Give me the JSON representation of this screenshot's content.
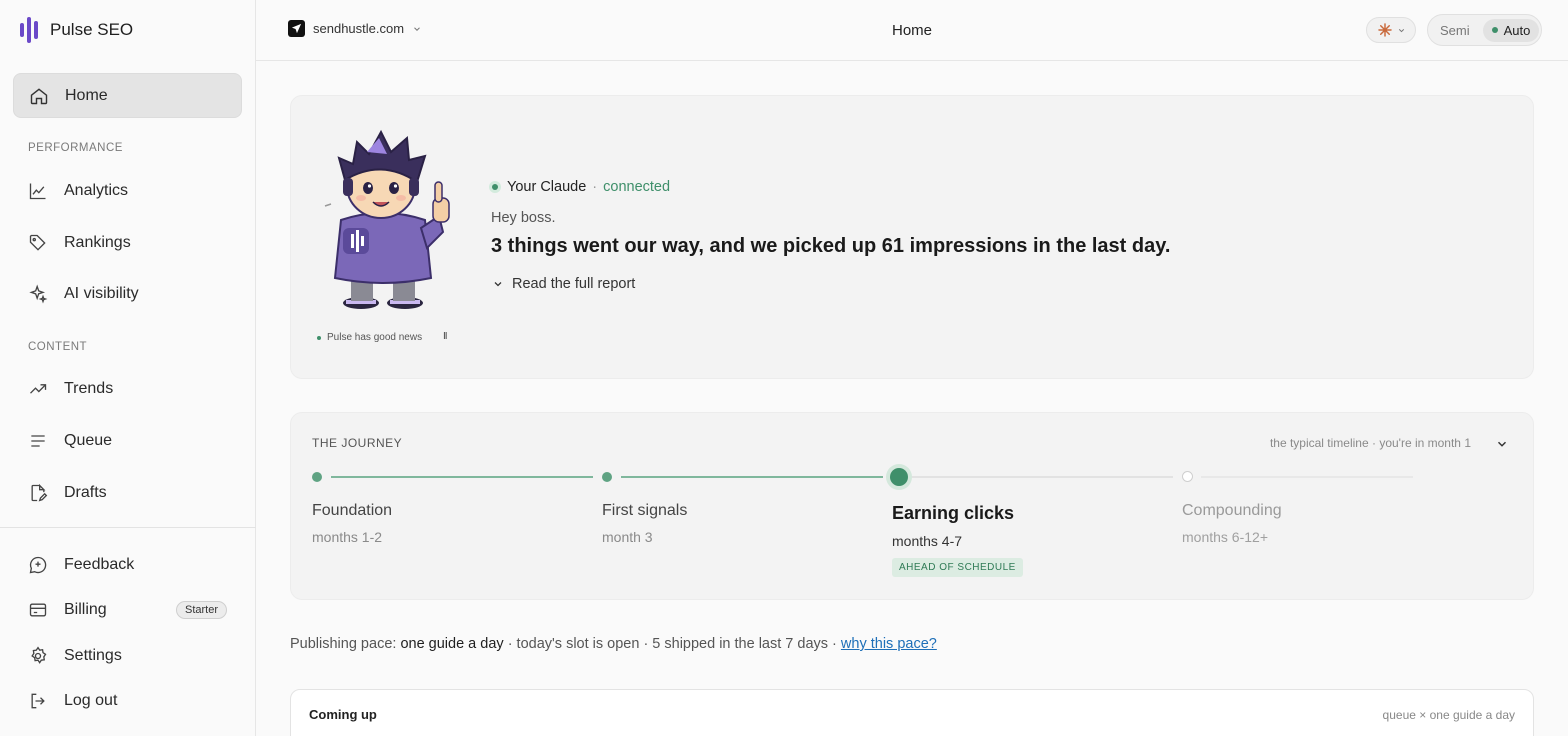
{
  "brand": {
    "name": "Pulse SEO",
    "accent": "#6b49c8"
  },
  "sidebar": {
    "home": "Home",
    "performance_label": "PERFORMANCE",
    "performance": [
      {
        "label": "Analytics",
        "icon": "chart-line-icon"
      },
      {
        "label": "Rankings",
        "icon": "tag-icon"
      },
      {
        "label": "AI visibility",
        "icon": "sparkle-icon"
      }
    ],
    "content_label": "CONTENT",
    "content": [
      {
        "label": "Trends",
        "icon": "trending-up-icon"
      },
      {
        "label": "Queue",
        "icon": "list-icon"
      },
      {
        "label": "Drafts",
        "icon": "document-edit-icon"
      }
    ],
    "bottom": [
      {
        "label": "Feedback",
        "icon": "feedback-icon"
      },
      {
        "label": "Billing",
        "icon": "credit-card-icon",
        "badge": "Starter"
      },
      {
        "label": "Settings",
        "icon": "gear-icon"
      },
      {
        "label": "Log out",
        "icon": "logout-icon"
      }
    ]
  },
  "topbar": {
    "site": "sendhustle.com",
    "title": "Home",
    "mode": {
      "options": [
        "Semi",
        "Auto"
      ],
      "selected": "Auto"
    }
  },
  "hero": {
    "agent_name": "Your Claude",
    "separator": "·",
    "status": "connected",
    "greeting": "Hey boss.",
    "headline": "3 things went our way, and we picked up 61 impressions in the last day.",
    "read_more": "Read the full report",
    "mascot_status": "Pulse has good news",
    "pause_symbol": "II"
  },
  "journey": {
    "label": "THE JOURNEY",
    "note": "the typical timeline · you're in month 1",
    "stages": [
      {
        "name": "Foundation",
        "period": "months 1-2",
        "state": "done"
      },
      {
        "name": "First signals",
        "period": "month 3",
        "state": "done"
      },
      {
        "name": "Earning clicks",
        "period": "months 4-7",
        "state": "current",
        "badge": "AHEAD OF SCHEDULE"
      },
      {
        "name": "Compounding",
        "period": "months 6-12+",
        "state": "upcoming"
      }
    ],
    "colors": {
      "done": "#5fa383",
      "current": "#3f8f6a",
      "upcoming": "#cfcfcf"
    }
  },
  "pace": {
    "prefix": "Publishing pace:",
    "rate": "one guide a day",
    "details": "· today's slot is open · 5 shipped in the last 7 days ·",
    "link": "why this pace?"
  },
  "coming_up": {
    "title": "Coming up",
    "note": "queue × one guide a day"
  }
}
